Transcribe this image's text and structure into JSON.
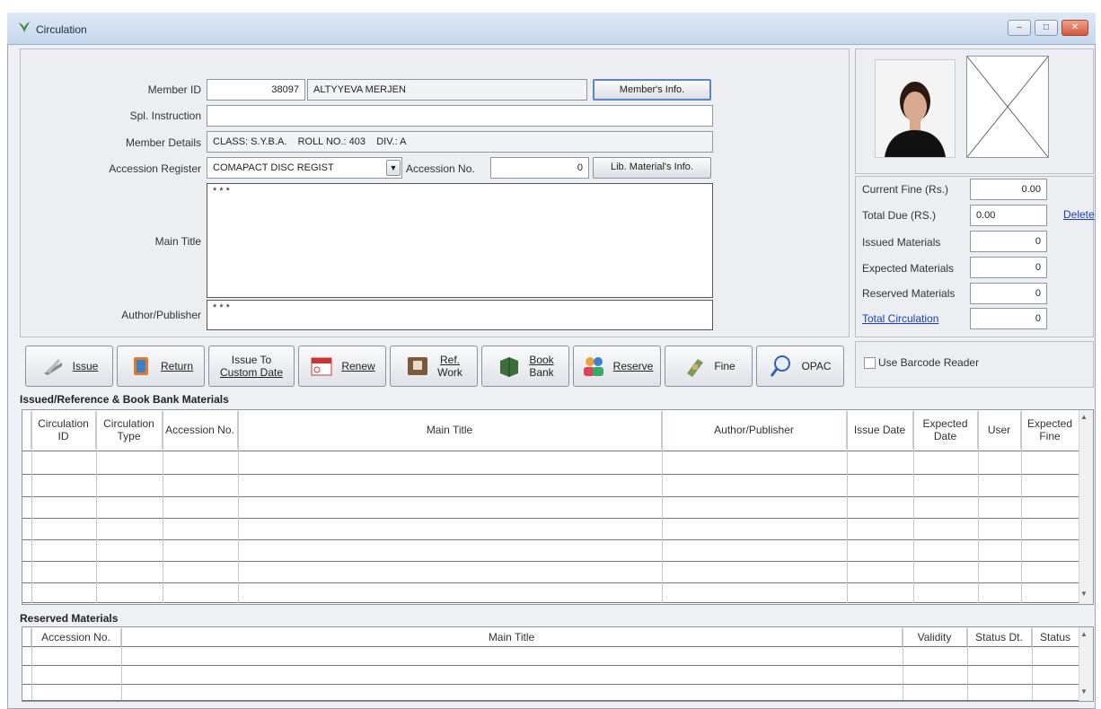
{
  "window": {
    "title": "Circulation",
    "controls": {
      "minimize": "–",
      "maximize": "□",
      "close": "✕"
    }
  },
  "member": {
    "id_label": "Member ID",
    "id": "38097",
    "name": "ALTYYEVA MERJEN",
    "info_button": "Member's Info.",
    "spl_label": "Spl. Instruction",
    "spl_value": "",
    "details_label": "Member Details",
    "details": "CLASS: S.Y.B.A.    ROLL NO.: 403    DIV.: A"
  },
  "accession": {
    "register_label": "Accession Register",
    "register_value": "COMAPACT DISC REGIST",
    "no_label": "Accession No.",
    "no_value": "0",
    "info_button": "Lib. Material's Info."
  },
  "main_title": {
    "label": "Main Title",
    "value": "* * *"
  },
  "author": {
    "label": "Author/Publisher",
    "value": "* * *"
  },
  "stats": {
    "current_fine_label": "Current Fine (Rs.)",
    "current_fine": "0.00",
    "total_due_label": "Total Due (RS.)",
    "total_due": "0.00",
    "delete_link": "Delete",
    "issued_label": "Issued Materials",
    "issued": "0",
    "expected_label": "Expected Materials",
    "expected": "0",
    "reserved_label": "Reserved Materials",
    "reserved": "0",
    "total_circ_label": "Total Circulation",
    "total_circ": "0"
  },
  "actions": {
    "issue": "Issue",
    "return": "Return",
    "issue_custom_1": "Issue To",
    "issue_custom_2": "Custom Date",
    "renew": "Renew",
    "ref_1": "Ref.",
    "ref_2": "Work",
    "book_1": "Book",
    "book_2": "Bank",
    "reserve": "Reserve",
    "fine": "Fine",
    "opac": "OPAC"
  },
  "barcode": {
    "label": "Use Barcode Reader",
    "checked": false
  },
  "issued_grid": {
    "title": "Issued/Reference & Book Bank Materials",
    "columns": [
      "Circulation ID",
      "Circulation Type",
      "Accession No.",
      "Main Title",
      "Author/Publisher",
      "Issue Date",
      "Expected Date",
      "User",
      "Expected Fine"
    ],
    "rows": []
  },
  "reserved_grid": {
    "title": "Reserved Materials",
    "columns": [
      "Accession No.",
      "Main Title",
      "Validity",
      "Status Dt.",
      "Status"
    ],
    "rows": []
  },
  "colors": {
    "titlebar": "#c5d6ec",
    "link": "#1a3ccb",
    "panel": "#eceef1"
  },
  "icons": [
    "app-icon",
    "issue-icon",
    "return-icon",
    "renew-icon",
    "ref-work-icon",
    "book-bank-icon",
    "reserve-icon",
    "fine-icon",
    "opac-icon",
    "dropdown-icon",
    "scroll-up-icon",
    "scroll-down-icon"
  ]
}
